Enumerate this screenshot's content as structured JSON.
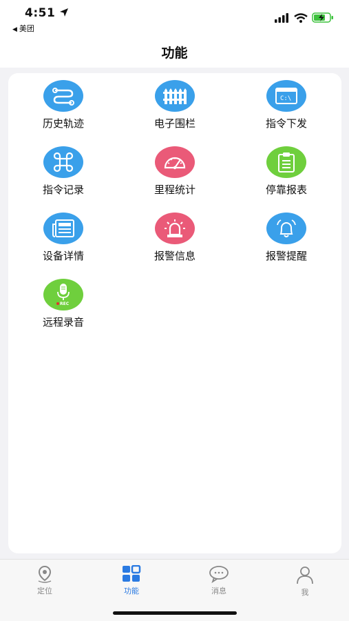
{
  "status": {
    "time": "4:51",
    "back_app": "美团",
    "battery_color": "#3cc23c"
  },
  "nav": {
    "title": "功能"
  },
  "functions": [
    {
      "label": "历史轨迹",
      "icon": "route-icon",
      "color": "#3aa0ea"
    },
    {
      "label": "电子围栏",
      "icon": "fence-icon",
      "color": "#3aa0ea"
    },
    {
      "label": "指令下发",
      "icon": "command-window-icon",
      "color": "#3aa0ea"
    },
    {
      "label": "指令记录",
      "icon": "command-key-icon",
      "color": "#3aa0ea"
    },
    {
      "label": "里程统计",
      "icon": "speedometer-icon",
      "color": "#ea5a78"
    },
    {
      "label": "停靠报表",
      "icon": "clipboard-icon",
      "color": "#6fcf3d"
    },
    {
      "label": "设备详情",
      "icon": "newspaper-icon",
      "color": "#3aa0ea"
    },
    {
      "label": "报警信息",
      "icon": "alarm-light-icon",
      "color": "#ea5a78"
    },
    {
      "label": "报警提醒",
      "icon": "bell-icon",
      "color": "#3aa0ea"
    },
    {
      "label": "远程录音",
      "icon": "microphone-rec-icon",
      "color": "#6fcf3d",
      "badge": "REC"
    }
  ],
  "tabs": [
    {
      "label": "定位",
      "icon": "location-pin-icon",
      "active": false
    },
    {
      "label": "功能",
      "icon": "grid-apps-icon",
      "active": true
    },
    {
      "label": "消息",
      "icon": "chat-bubble-icon",
      "active": false
    },
    {
      "label": "我",
      "icon": "person-icon",
      "active": false
    }
  ],
  "colors": {
    "accent": "#2a7ae2",
    "inactive": "#888888"
  }
}
